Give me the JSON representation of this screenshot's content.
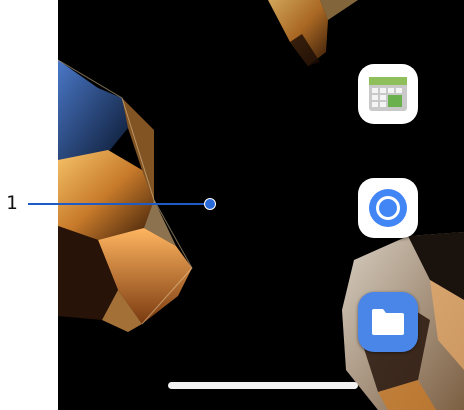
{
  "annotation": {
    "label": "1",
    "color": "#2a6ad8"
  },
  "home_screen": {
    "apps": [
      {
        "name": "calendar-app",
        "icon": "calendar-grid-icon"
      },
      {
        "name": "chrome-app",
        "icon": "chrome-icon"
      },
      {
        "name": "files-app",
        "icon": "folder-icon"
      }
    ],
    "navigation": {
      "gesture_handle": "home-gesture-bar"
    }
  },
  "colors": {
    "wallpaper_base": "#000000",
    "chrome_blue": "#4285f4",
    "files_blue": "#4a86e8",
    "calendar_green": "#6ab04c"
  }
}
